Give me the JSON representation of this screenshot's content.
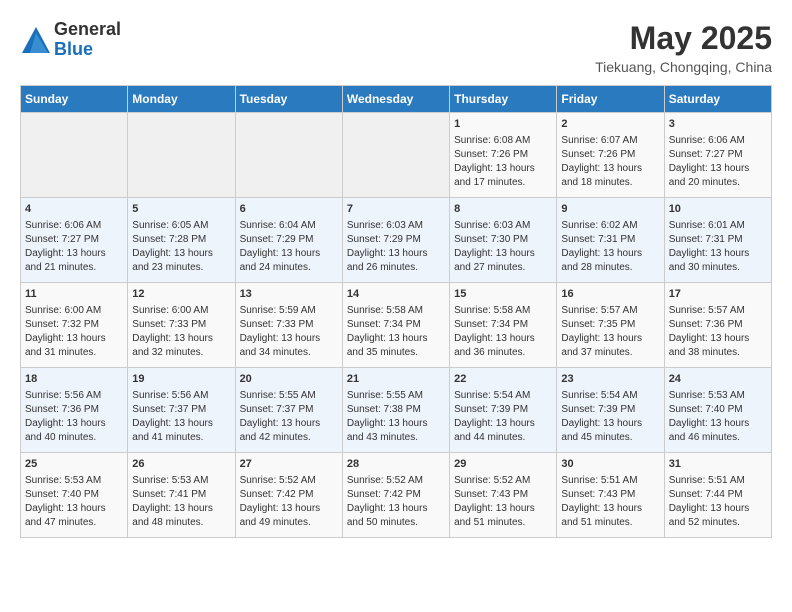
{
  "header": {
    "logo_general": "General",
    "logo_blue": "Blue",
    "month": "May 2025",
    "location": "Tiekuang, Chongqing, China"
  },
  "weekdays": [
    "Sunday",
    "Monday",
    "Tuesday",
    "Wednesday",
    "Thursday",
    "Friday",
    "Saturday"
  ],
  "weeks": [
    [
      {
        "day": "",
        "info": ""
      },
      {
        "day": "",
        "info": ""
      },
      {
        "day": "",
        "info": ""
      },
      {
        "day": "",
        "info": ""
      },
      {
        "day": "1",
        "info": "Sunrise: 6:08 AM\nSunset: 7:26 PM\nDaylight: 13 hours and 17 minutes."
      },
      {
        "day": "2",
        "info": "Sunrise: 6:07 AM\nSunset: 7:26 PM\nDaylight: 13 hours and 18 minutes."
      },
      {
        "day": "3",
        "info": "Sunrise: 6:06 AM\nSunset: 7:27 PM\nDaylight: 13 hours and 20 minutes."
      }
    ],
    [
      {
        "day": "4",
        "info": "Sunrise: 6:06 AM\nSunset: 7:27 PM\nDaylight: 13 hours and 21 minutes."
      },
      {
        "day": "5",
        "info": "Sunrise: 6:05 AM\nSunset: 7:28 PM\nDaylight: 13 hours and 23 minutes."
      },
      {
        "day": "6",
        "info": "Sunrise: 6:04 AM\nSunset: 7:29 PM\nDaylight: 13 hours and 24 minutes."
      },
      {
        "day": "7",
        "info": "Sunrise: 6:03 AM\nSunset: 7:29 PM\nDaylight: 13 hours and 26 minutes."
      },
      {
        "day": "8",
        "info": "Sunrise: 6:03 AM\nSunset: 7:30 PM\nDaylight: 13 hours and 27 minutes."
      },
      {
        "day": "9",
        "info": "Sunrise: 6:02 AM\nSunset: 7:31 PM\nDaylight: 13 hours and 28 minutes."
      },
      {
        "day": "10",
        "info": "Sunrise: 6:01 AM\nSunset: 7:31 PM\nDaylight: 13 hours and 30 minutes."
      }
    ],
    [
      {
        "day": "11",
        "info": "Sunrise: 6:00 AM\nSunset: 7:32 PM\nDaylight: 13 hours and 31 minutes."
      },
      {
        "day": "12",
        "info": "Sunrise: 6:00 AM\nSunset: 7:33 PM\nDaylight: 13 hours and 32 minutes."
      },
      {
        "day": "13",
        "info": "Sunrise: 5:59 AM\nSunset: 7:33 PM\nDaylight: 13 hours and 34 minutes."
      },
      {
        "day": "14",
        "info": "Sunrise: 5:58 AM\nSunset: 7:34 PM\nDaylight: 13 hours and 35 minutes."
      },
      {
        "day": "15",
        "info": "Sunrise: 5:58 AM\nSunset: 7:34 PM\nDaylight: 13 hours and 36 minutes."
      },
      {
        "day": "16",
        "info": "Sunrise: 5:57 AM\nSunset: 7:35 PM\nDaylight: 13 hours and 37 minutes."
      },
      {
        "day": "17",
        "info": "Sunrise: 5:57 AM\nSunset: 7:36 PM\nDaylight: 13 hours and 38 minutes."
      }
    ],
    [
      {
        "day": "18",
        "info": "Sunrise: 5:56 AM\nSunset: 7:36 PM\nDaylight: 13 hours and 40 minutes."
      },
      {
        "day": "19",
        "info": "Sunrise: 5:56 AM\nSunset: 7:37 PM\nDaylight: 13 hours and 41 minutes."
      },
      {
        "day": "20",
        "info": "Sunrise: 5:55 AM\nSunset: 7:37 PM\nDaylight: 13 hours and 42 minutes."
      },
      {
        "day": "21",
        "info": "Sunrise: 5:55 AM\nSunset: 7:38 PM\nDaylight: 13 hours and 43 minutes."
      },
      {
        "day": "22",
        "info": "Sunrise: 5:54 AM\nSunset: 7:39 PM\nDaylight: 13 hours and 44 minutes."
      },
      {
        "day": "23",
        "info": "Sunrise: 5:54 AM\nSunset: 7:39 PM\nDaylight: 13 hours and 45 minutes."
      },
      {
        "day": "24",
        "info": "Sunrise: 5:53 AM\nSunset: 7:40 PM\nDaylight: 13 hours and 46 minutes."
      }
    ],
    [
      {
        "day": "25",
        "info": "Sunrise: 5:53 AM\nSunset: 7:40 PM\nDaylight: 13 hours and 47 minutes."
      },
      {
        "day": "26",
        "info": "Sunrise: 5:53 AM\nSunset: 7:41 PM\nDaylight: 13 hours and 48 minutes."
      },
      {
        "day": "27",
        "info": "Sunrise: 5:52 AM\nSunset: 7:42 PM\nDaylight: 13 hours and 49 minutes."
      },
      {
        "day": "28",
        "info": "Sunrise: 5:52 AM\nSunset: 7:42 PM\nDaylight: 13 hours and 50 minutes."
      },
      {
        "day": "29",
        "info": "Sunrise: 5:52 AM\nSunset: 7:43 PM\nDaylight: 13 hours and 51 minutes."
      },
      {
        "day": "30",
        "info": "Sunrise: 5:51 AM\nSunset: 7:43 PM\nDaylight: 13 hours and 51 minutes."
      },
      {
        "day": "31",
        "info": "Sunrise: 5:51 AM\nSunset: 7:44 PM\nDaylight: 13 hours and 52 minutes."
      }
    ]
  ]
}
